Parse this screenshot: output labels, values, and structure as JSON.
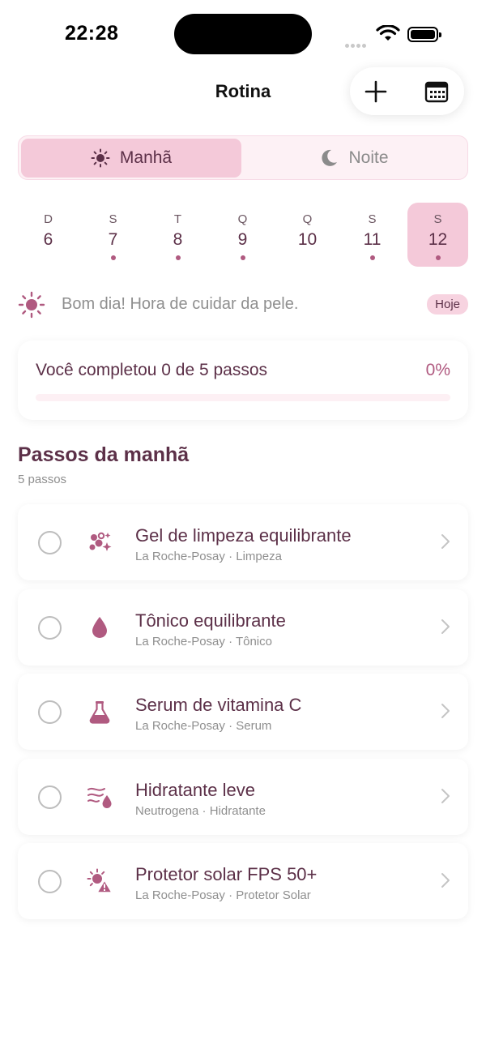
{
  "status_bar": {
    "time": "22:28"
  },
  "nav": {
    "title": "Rotina",
    "add_icon": "plus-icon",
    "calendar_icon": "calendar-icon"
  },
  "segment": {
    "options": [
      {
        "label": "Manhã",
        "icon": "sun-icon",
        "selected": true
      },
      {
        "label": "Noite",
        "icon": "moon-icon",
        "selected": false
      }
    ]
  },
  "week": [
    {
      "letter": "D",
      "day": "6",
      "dot": false,
      "selected": false
    },
    {
      "letter": "S",
      "day": "7",
      "dot": true,
      "selected": false
    },
    {
      "letter": "T",
      "day": "8",
      "dot": true,
      "selected": false
    },
    {
      "letter": "Q",
      "day": "9",
      "dot": true,
      "selected": false
    },
    {
      "letter": "Q",
      "day": "10",
      "dot": false,
      "selected": false
    },
    {
      "letter": "S",
      "day": "11",
      "dot": true,
      "selected": false
    },
    {
      "letter": "S",
      "day": "12",
      "dot": true,
      "selected": true
    }
  ],
  "greeting": {
    "text": "Bom dia! Hora de cuidar da pele.",
    "badge": "Hoje"
  },
  "progress": {
    "text": "Você completou 0 de 5 passos",
    "percent_label": "0%",
    "fraction": 0
  },
  "section": {
    "title": "Passos da manhã",
    "subtitle": "5 passos"
  },
  "steps": [
    {
      "name": "Gel de limpeza equilibrante",
      "meta": "La Roche-Posay · Limpeza",
      "icon": "bubbles-icon"
    },
    {
      "name": "Tônico equilibrante",
      "meta": "La Roche-Posay · Tônico",
      "icon": "drop-icon"
    },
    {
      "name": "Serum de vitamina C",
      "meta": "La Roche-Posay · Serum",
      "icon": "flask-icon"
    },
    {
      "name": "Hidratante leve",
      "meta": "Neutrogena · Hidratante",
      "icon": "wave-drop-icon"
    },
    {
      "name": "Protetor solar FPS 50+",
      "meta": "La Roche-Posay · Protetor Solar",
      "icon": "sun-warning-icon"
    }
  ],
  "colors": {
    "accent": "#b05a80",
    "accent_light": "#f4c9d9",
    "text": "#5c3048"
  }
}
